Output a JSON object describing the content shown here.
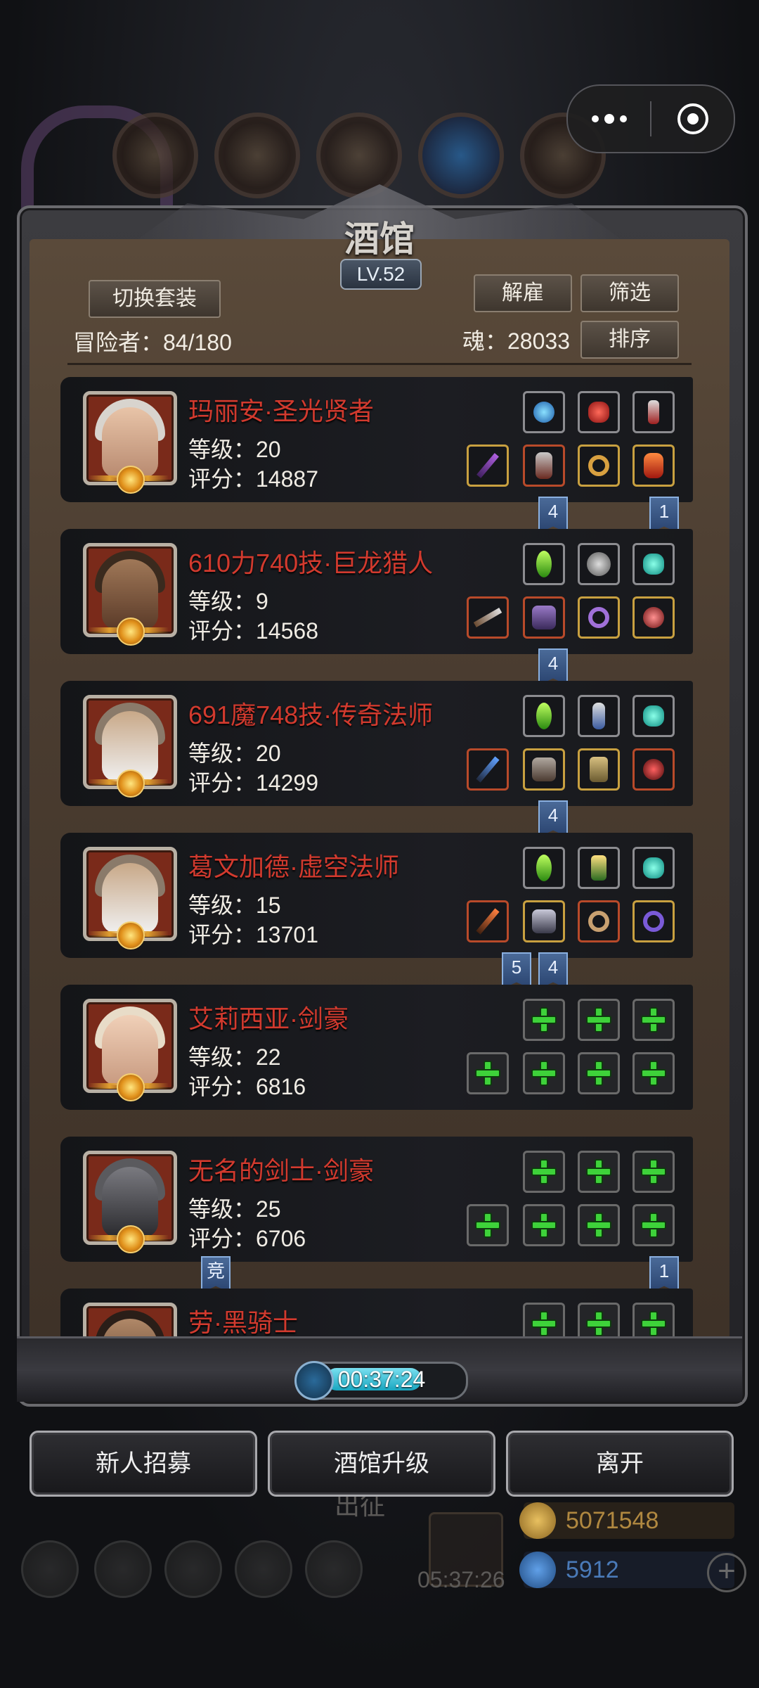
{
  "app": {
    "title": "酒馆",
    "level": "LV.52"
  },
  "toolbar": {
    "switch_set_label": "切换套装",
    "dismiss_label": "解雇",
    "filter_label": "筛选",
    "sort_label": "排序"
  },
  "stats": {
    "adventurers": "冒险者：84/180",
    "soul": "魂：28033"
  },
  "heroes": [
    {
      "name": "玛丽安·圣光贤者",
      "level": "等级：20",
      "score": "评分：14887",
      "badges": [
        "4",
        "1"
      ]
    },
    {
      "name": "610力740技·巨龙猎人",
      "level": "等级：9",
      "score": "评分：14568",
      "badges": [
        "4"
      ]
    },
    {
      "name": "691魔748技·传奇法师",
      "level": "等级：20",
      "score": "评分：14299",
      "badges": [
        "4"
      ]
    },
    {
      "name": "葛文加德·虚空法师",
      "level": "等级：15",
      "score": "评分：13701",
      "badges": [
        "5",
        "4"
      ]
    },
    {
      "name": "艾莉西亚·剑豪",
      "level": "等级：22",
      "score": "评分：6816",
      "badges": []
    },
    {
      "name": "无名的剑士·剑豪",
      "level": "等级：25",
      "score": "评分：6706",
      "badges": [
        "竞",
        "1"
      ]
    },
    {
      "name": "劳·黑骑士",
      "level": "",
      "score": "",
      "badges": []
    }
  ],
  "timer": {
    "value": "00:37:24",
    "progress": 0.72
  },
  "actions": {
    "recruit": "新人招募",
    "upgrade": "酒馆升级",
    "leave": "离开"
  },
  "background": {
    "expedition": "出征",
    "gift_timer": "05:37:26",
    "gold": "5071548",
    "gems": "5912"
  },
  "colors": {
    "hero_name": "#d23a2e",
    "timer_fill": "#18a6c0",
    "plus": "#3ed23a"
  }
}
